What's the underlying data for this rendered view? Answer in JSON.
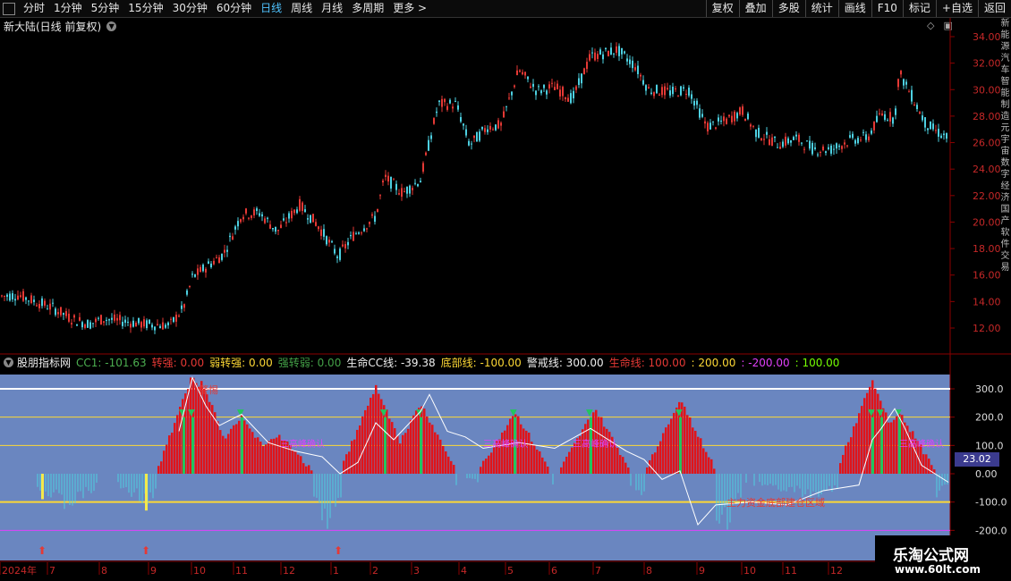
{
  "toolbar": {
    "periods": [
      "分时",
      "1分钟",
      "5分钟",
      "15分钟",
      "30分钟",
      "60分钟",
      "日线",
      "周线",
      "月线",
      "多周期",
      "更多 >"
    ],
    "active_period": "日线",
    "right_buttons": [
      "复权",
      "叠加",
      "多股",
      "统计",
      "画线",
      "F10",
      "标记",
      "+自选",
      "返回"
    ]
  },
  "main_title": "新大陆(日线 前复权)",
  "price_axis": [
    "34.00",
    "32.00",
    "30.00",
    "28.00",
    "26.00",
    "24.00",
    "22.00",
    "20.00",
    "18.00",
    "16.00",
    "14.00",
    "12.00"
  ],
  "indicator": {
    "name": "股朋指标网",
    "items": [
      {
        "label": "CC1: ",
        "value": "-101.63",
        "color": "#4caf50"
      },
      {
        "label": "转强: ",
        "value": "0.00",
        "color": "#e53935"
      },
      {
        "label": "弱转强: ",
        "value": "0.00",
        "color": "#fdd835"
      },
      {
        "label": "强转弱: ",
        "value": "0.00",
        "color": "#43a047"
      },
      {
        "label": "生命CC线: ",
        "value": "-39.38",
        "color": "#eeeeee"
      },
      {
        "label": "底部线: ",
        "value": "-100.00",
        "color": "#fdd835"
      },
      {
        "label": "警戒线: ",
        "value": "300.00",
        "color": "#eeeeee"
      },
      {
        "label": "生命线: ",
        "value": "100.00",
        "color": "#e53935"
      },
      {
        "label": ": ",
        "value": "200.00",
        "color": "#fdd835"
      },
      {
        "label": ": ",
        "value": "-200.00",
        "color": "#e040fb"
      },
      {
        "label": ": ",
        "value": "100.00",
        "color": "#76ff03"
      }
    ]
  },
  "indicator_axis": [
    "300.0",
    "200.0",
    "100.0",
    "0.00",
    "-100.0",
    "-200.0"
  ],
  "current_value": "23.02",
  "annotations": {
    "warning": "警惕",
    "pink": "三高峰确认",
    "red_bottom": "主力资金底部建仓区域"
  },
  "date_axis": [
    "2024年",
    "7",
    "8",
    "9",
    "10",
    "11",
    "12",
    "1",
    "2",
    "3",
    "4",
    "5",
    "6",
    "7",
    "8",
    "9",
    "10",
    "11",
    "12"
  ],
  "right_side_text": [
    "新",
    "能",
    "源",
    "汽",
    "车",
    "智",
    "能",
    "制",
    "造",
    "元",
    "宇",
    "宙",
    "数",
    "字",
    "经",
    "济",
    "国",
    "产",
    "软",
    "件",
    "交",
    "易"
  ],
  "logo": {
    "line1": "乐淘公式网",
    "line2": "www.60lt.com"
  },
  "colors": {
    "up": "#e53935",
    "down": "#4dd0e1",
    "panel_bg": "#6a86c0",
    "axis": "#8b0000"
  }
}
